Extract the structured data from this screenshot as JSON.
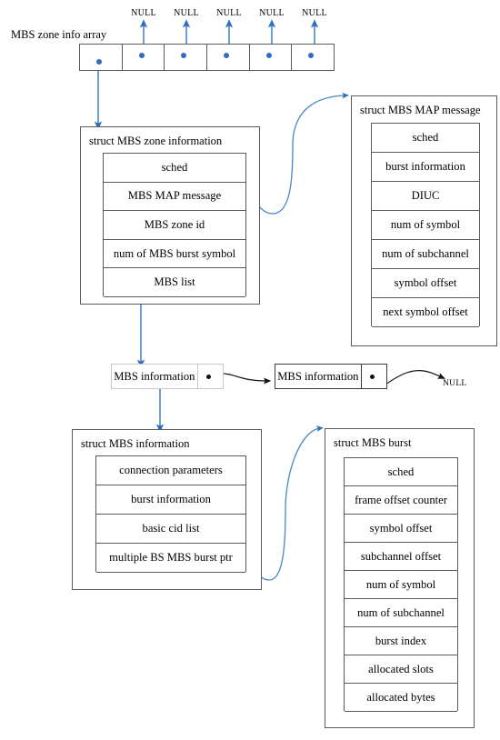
{
  "diagram": {
    "title": "MBS zone info array",
    "colors": {
      "pointer_blue": "#2e6fba",
      "box_border": "#5a5a5a",
      "node_border_dark": "#3a3a3a",
      "node_border_light": "#c9c9c9",
      "black_arrow": "#101010"
    },
    "array": {
      "label": "MBS zone info array",
      "cells": [
        {
          "id": "cell-0",
          "null_label": null
        },
        {
          "id": "cell-1",
          "null_label": "NULL"
        },
        {
          "id": "cell-2",
          "null_label": "NULL"
        },
        {
          "id": "cell-3",
          "null_label": "NULL"
        },
        {
          "id": "cell-4",
          "null_label": "NULL"
        },
        {
          "id": "cell-5",
          "null_label": "NULL"
        }
      ]
    },
    "structs": {
      "zone_information": {
        "caption": "struct MBS zone information",
        "fields": [
          "sched",
          "MBS MAP message",
          "MBS zone id",
          "num of MBS burst symbol",
          "MBS list"
        ]
      },
      "map_message": {
        "caption": "struct MBS MAP message",
        "fields": [
          "sched",
          "burst information",
          "DIUC",
          "num of symbol",
          "num of subchannel",
          "symbol offset",
          "next symbol offset"
        ]
      },
      "mbs_information": {
        "caption": "struct MBS information",
        "fields": [
          "connection parameters",
          "burst information",
          "basic cid list",
          "multiple BS MBS burst ptr"
        ]
      },
      "mbs_burst": {
        "caption": "struct MBS burst",
        "fields": [
          "sched",
          "frame offset counter",
          "symbol offset",
          "subchannel offset",
          "num of symbol",
          "num of subchannel",
          "burst index",
          "allocated slots",
          "allocated bytes"
        ]
      }
    },
    "list": {
      "nodes": [
        {
          "label": "MBS information",
          "style": "light"
        },
        {
          "label": "MBS information",
          "style": "dark"
        }
      ],
      "tail_null": "NULL"
    }
  }
}
